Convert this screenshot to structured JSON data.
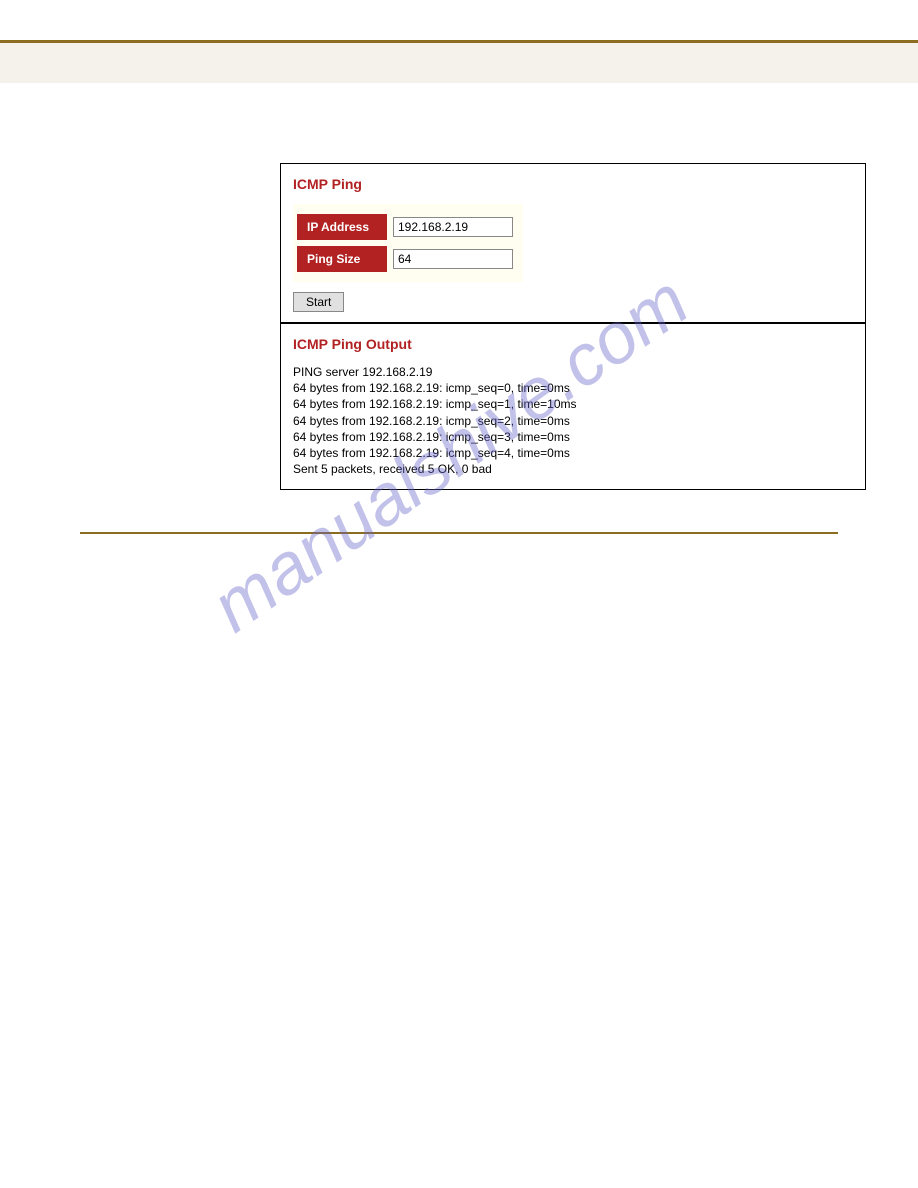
{
  "icmp_panel": {
    "title": "ICMP Ping",
    "ip_label": "IP Address",
    "ip_value": "192.168.2.19",
    "size_label": "Ping Size",
    "size_value": "64",
    "start_label": "Start"
  },
  "output_panel": {
    "title": "ICMP Ping Output",
    "lines": [
      "PING server 192.168.2.19",
      "64 bytes from 192.168.2.19: icmp_seq=0, time=0ms",
      "64 bytes from 192.168.2.19: icmp_seq=1, time=10ms",
      "64 bytes from 192.168.2.19: icmp_seq=2, time=0ms",
      "64 bytes from 192.168.2.19: icmp_seq=3, time=0ms",
      "64 bytes from 192.168.2.19: icmp_seq=4, time=0ms",
      "Sent 5 packets, received 5 OK, 0 bad"
    ]
  },
  "watermark": "manualshive.com"
}
